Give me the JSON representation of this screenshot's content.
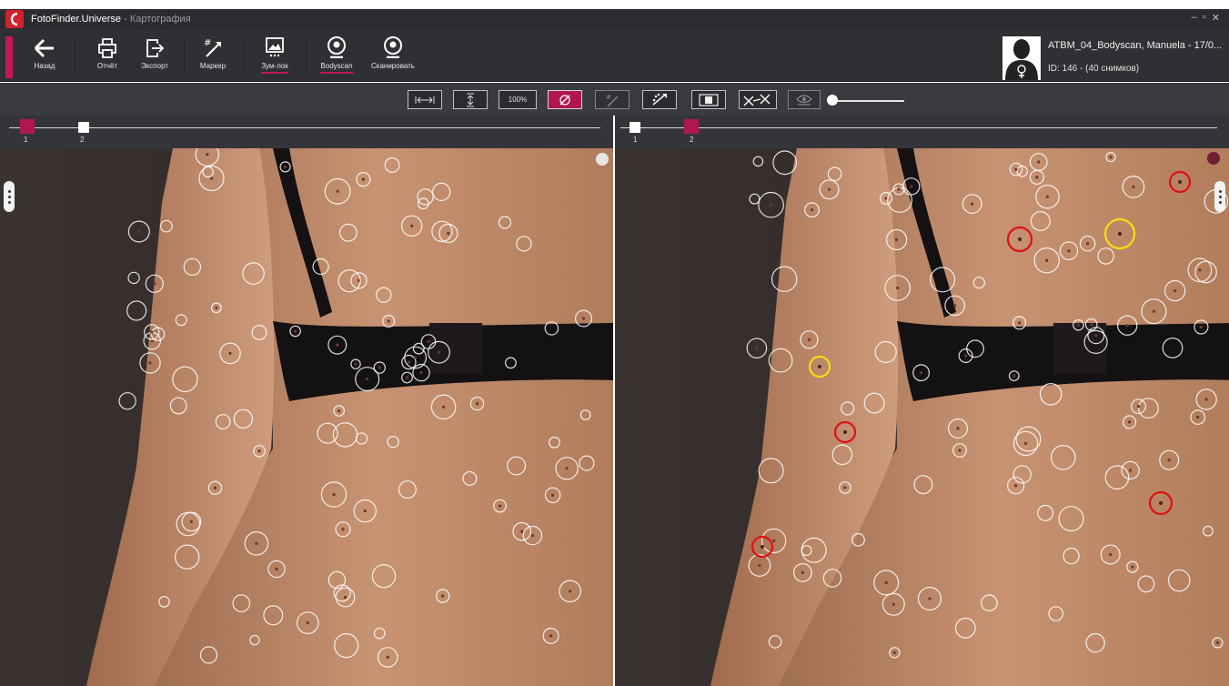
{
  "window": {
    "app_name": "FotoFinder.Universe",
    "separator": " - ",
    "module_name": "Картография",
    "controls": [
      "–",
      "▫",
      "✕"
    ]
  },
  "toolbar": {
    "back_label": "Назад",
    "report_label": "Отчёт",
    "export_label": "Экспорт",
    "marker_label": "Маркер",
    "zoom_label": "Зум-лок",
    "bodyscan_label": "Bodyscan",
    "scan_label": "Сканировать"
  },
  "patient": {
    "name": "ATBM_04_Bodyscan, Manuela - 17/0...",
    "id_line": "ID: 146 - (40 снимков)"
  },
  "viewbar": {
    "zoom_100_label": "100%",
    "active_tool": "lesion-marking",
    "opacity_slider_value": 0
  },
  "timelines": {
    "left": {
      "labels": [
        "1",
        "2"
      ],
      "current": "1"
    },
    "right": {
      "labels": [
        "1",
        "2"
      ],
      "current": "2"
    }
  },
  "colors": {
    "accent": "#b0174f",
    "new_lesion": "#e01010",
    "changed_lesion": "#f0e010",
    "lesion_marker": "#ffffff"
  },
  "lesions": {
    "left_count": 100,
    "right_count": 98,
    "right_new_count": 6,
    "right_changed_count": 2
  }
}
